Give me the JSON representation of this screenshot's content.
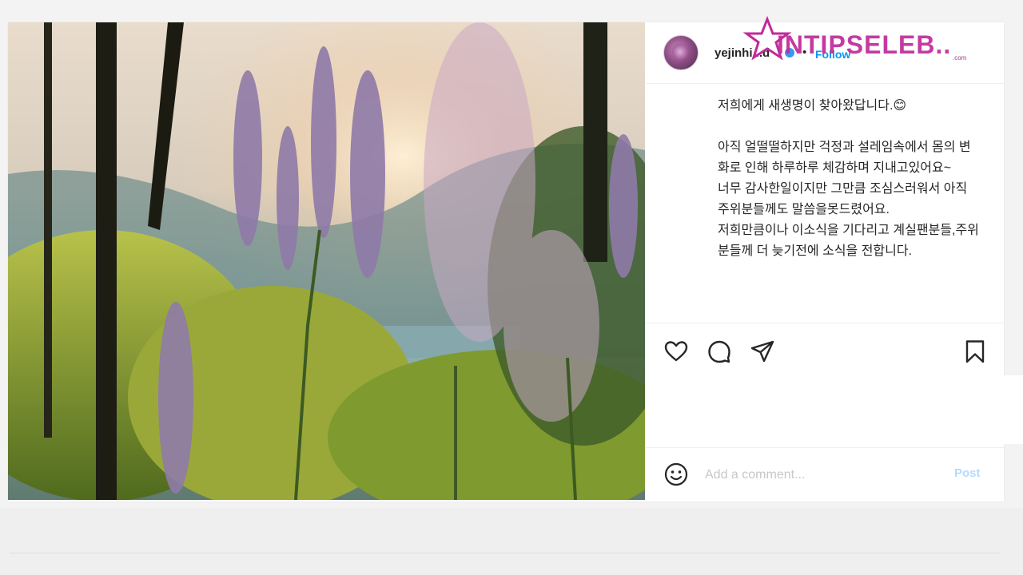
{
  "post": {
    "username": "yejinhi...d",
    "follow_label": "Follow",
    "separator": "•",
    "caption": "저희에게 새생명이 찾아왔답니다.😊\n\n아직 얼떨떨하지만 걱정과 설레임속에서 몸의 변화로 인해 하루하루 체감하며 지내고있어요~\n너무 감사한일이지만 그만큼 조심스러워서 아직 주위분들께도 말씀을못드렸어요.\n저희만큼이나 이소식을 기다리고 계실팬분들,주위분들께 더 늦기전에 소식을 전합니다.",
    "image_description": "flowers"
  },
  "watermark": {
    "text": "INTIPSELEB..",
    "sub": ".com"
  },
  "actions": {
    "like_icon": "heart-icon",
    "comment_icon": "comment-icon",
    "share_icon": "share-icon",
    "save_icon": "bookmark-icon"
  },
  "comment": {
    "placeholder": "Add a comment...",
    "post_label": "Post",
    "emoji_icon": "smiley-icon"
  },
  "colors": {
    "link_blue": "#0095f6",
    "post_disabled": "#b3dbff",
    "watermark": "#c02a9a"
  }
}
